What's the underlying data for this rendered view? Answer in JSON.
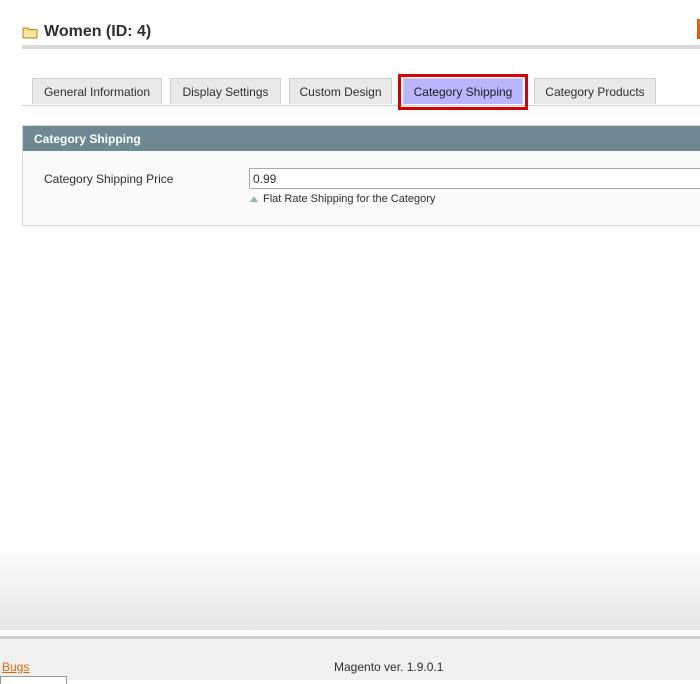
{
  "header": {
    "title": "Women (ID: 4)",
    "icon": "folder-icon"
  },
  "tabs": [
    {
      "label": "General Information",
      "active": false
    },
    {
      "label": "Display Settings",
      "active": false
    },
    {
      "label": "Custom Design",
      "active": false
    },
    {
      "label": "Category Shipping",
      "active": true
    },
    {
      "label": "Category Products",
      "active": false
    }
  ],
  "section": {
    "title": "Category Shipping",
    "field_label": "Category Shipping Price",
    "field_value": "0.99",
    "note": "Flat Rate Shipping for the Category"
  },
  "footer": {
    "bugs_link": "Bugs",
    "version": "Magento ver. 1.9.0.1"
  },
  "colors": {
    "section_header": "#6f8992",
    "active_tab": "#b9b5ff",
    "highlight_border": "#d60000",
    "link": "#e06700"
  }
}
